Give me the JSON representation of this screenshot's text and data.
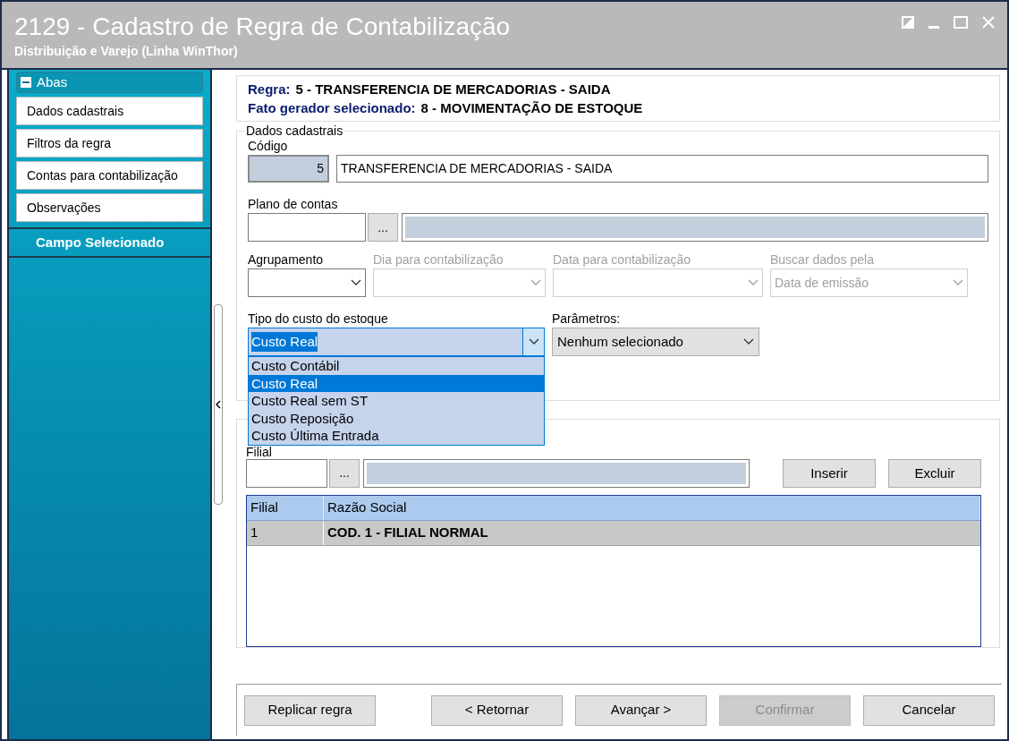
{
  "window": {
    "title": "2129 - Cadastro de Regra de Contabilização",
    "subtitle": "Distribuição e Varejo (Linha WinThor)"
  },
  "sidebar": {
    "header": "Abas",
    "expanded": true,
    "items": [
      {
        "label": "Dados cadastrais"
      },
      {
        "label": "Filtros da regra"
      },
      {
        "label": "Contas para contabilização"
      },
      {
        "label": "Observações"
      }
    ],
    "section": "Campo Selecionado"
  },
  "summary": [
    {
      "label": "Regra:",
      "value": "5 - TRANSFERENCIA DE MERCADORIAS - SAIDA"
    },
    {
      "label": "Fato gerador selecionado:",
      "value": "8 - MOVIMENTAÇÃO DE ESTOQUE"
    }
  ],
  "dados": {
    "legend": "Dados cadastrais",
    "codigo_label": "Código",
    "codigo": "5",
    "descricao": "TRANSFERENCIA DE MERCADORIAS - SAIDA",
    "plano_label": "Plano de contas",
    "plano_button": "...",
    "selects": [
      {
        "label": "Agrupamento",
        "disabled": false
      },
      {
        "label": "Dia para contabilização",
        "disabled": true
      },
      {
        "label": "Data para contabilização",
        "disabled": true
      },
      {
        "label": "Buscar dados pela",
        "value": "Data de emissão",
        "disabled": true
      }
    ],
    "tipo": {
      "label": "Tipo do custo do estoque",
      "value": "Custo Real",
      "expanded": true,
      "options": [
        {
          "label": "Custo Contábil",
          "selected": false
        },
        {
          "label": "Custo Real",
          "selected": true
        },
        {
          "label": "Custo Real sem ST",
          "selected": false
        },
        {
          "label": "Custo Reposição",
          "selected": false
        },
        {
          "label": "Custo Última Entrada",
          "selected": false
        }
      ]
    },
    "parametros": {
      "label": "Parâmetros:",
      "value": "Nenhum selecionado"
    }
  },
  "filiais": {
    "field_label": "Filial",
    "browse_button": "...",
    "buttons": [
      {
        "label": "Inserir"
      },
      {
        "label": "Excluir"
      }
    ],
    "table": {
      "columns": [
        "Filial",
        "Razão Social"
      ],
      "rows": [
        {
          "cells": [
            "1",
            "COD. 1 - FILIAL NORMAL"
          ],
          "selected": true
        }
      ]
    }
  },
  "footer": [
    {
      "label": "Replicar regra",
      "disabled": false
    },
    {
      "label": "< Retornar",
      "disabled": false
    },
    {
      "label": "Avançar >",
      "disabled": false
    },
    {
      "label": "Confirmar",
      "disabled": true
    },
    {
      "label": "Cancelar",
      "disabled": false
    }
  ]
}
